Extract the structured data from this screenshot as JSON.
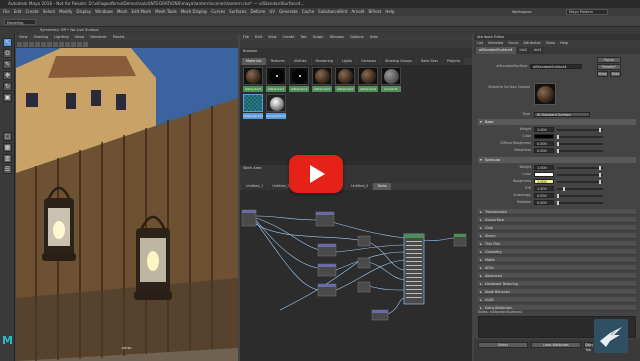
{
  "window": {
    "title": "Autodesk Maya 2016 - Not for Resale: D:\\villageofbrno\\Demos\\solo\\INTEGRATIONS\\maya\\lantern\\scenes\\lantern.ma* --- aiStandardSurface4..."
  },
  "menubar": [
    "File",
    "Edit",
    "Create",
    "Select",
    "Modify",
    "Display",
    "Windows",
    "Mesh",
    "Edit Mesh",
    "Mesh Tools",
    "Mesh Display",
    "Curves",
    "Surfaces",
    "Deform",
    "UV",
    "Generate",
    "Cache",
    "SubstanceBrnt",
    "Arnold",
    "Bifrost",
    "Help"
  ],
  "toolbar": {
    "workspace": "Modeling",
    "workspace_menu": "Maya Modern",
    "panels_label": "Workspace"
  },
  "shelf": {
    "label": "Symmetry: Off  •  No Live Surface"
  },
  "viewport": {
    "menu": [
      "View",
      "Shading",
      "Lighting",
      "Show",
      "Renderer",
      "Panels"
    ],
    "camera_label": "persp"
  },
  "hypershade": {
    "menu": [
      "File",
      "Edit",
      "View",
      "Create",
      "Tab",
      "Graph",
      "Window",
      "Options",
      "Help"
    ],
    "browser_title": "Browser",
    "browser_tabs": [
      "Materials",
      "Textures",
      "Utilities",
      "Rendering",
      "Lights",
      "Cameras",
      "Shading Groups",
      "Bake Sets",
      "Projects",
      "Assets"
    ],
    "swatch_labels": [
      "aiStandard",
      "aiStandard",
      "aiStandard",
      "aiStandard",
      "aiStandard",
      "aiStandard",
      "lambert1"
    ],
    "swatch_labels_row2": [
      "aiStandardSurface",
      "standardSurface"
    ],
    "node_tabs": [
      "Untitled_1",
      "Untitled_2",
      "Untitled_3",
      "Untitled_4",
      "Untitled_5",
      "Tanks"
    ],
    "work_area_label": "Work Area"
  },
  "attribute_editor": {
    "title": "Attribute Editor",
    "menu": [
      "List",
      "Selected",
      "Focus",
      "Attributes",
      "Show",
      "Help"
    ],
    "tabs": [
      "aiStandardSurface4",
      "tile2",
      "tile3"
    ],
    "surface_label": "aiStandardSurface:",
    "surface_name": "aiStandardSurface4",
    "buttons": {
      "focus": "Focus",
      "presets": "Presets*",
      "show": "Show",
      "hide": "Hide"
    },
    "sample_label": "Shaderfx Surface Sample",
    "type_label": "Type",
    "type_value": "Ai Standard Surface",
    "base": {
      "title": "Base",
      "weight_label": "Weight",
      "weight": "1.000",
      "color_label": "Color",
      "diffuse_label": "Diffuse Roughness",
      "diffuse": "0.000",
      "metalness_label": "Metalness",
      "metalness": "0.000"
    },
    "specular": {
      "title": "Specular",
      "weight_label": "Weight",
      "weight": "1.000",
      "color_label": "Color",
      "roughness_label": "Roughness",
      "roughness": "1.000",
      "ior_label": "IOR",
      "ior": "1.500",
      "anisotropy_label": "Anisotropy",
      "anisotropy": "0.000",
      "rotation_label": "Rotation",
      "rotation": "0.000"
    },
    "collapsed_sections": [
      "Transmission",
      "Subsurface",
      "Coat",
      "Sheen",
      "Thin Film",
      "Geometry",
      "Matte",
      "AOVs",
      "Advanced",
      "Hardware Texturing",
      "Node Behavior",
      "UUID",
      "Extra Attributes"
    ],
    "notes_label": "Notes: aiStandardSurface4",
    "bottom_buttons": [
      "Select",
      "Load Attributes",
      "Copy Tab"
    ]
  },
  "colors": {
    "accent": "#5a9ae0",
    "swatch_label": "#4e8f55",
    "play_button": "#e62117",
    "maya_logo": "#27c0c4"
  },
  "icons": [
    "select-tool-icon",
    "lasso-icon",
    "paint-icon",
    "move-icon",
    "rotate-icon",
    "scale-icon",
    "play-icon",
    "bird-logo-icon",
    "maya-logo-icon"
  ]
}
